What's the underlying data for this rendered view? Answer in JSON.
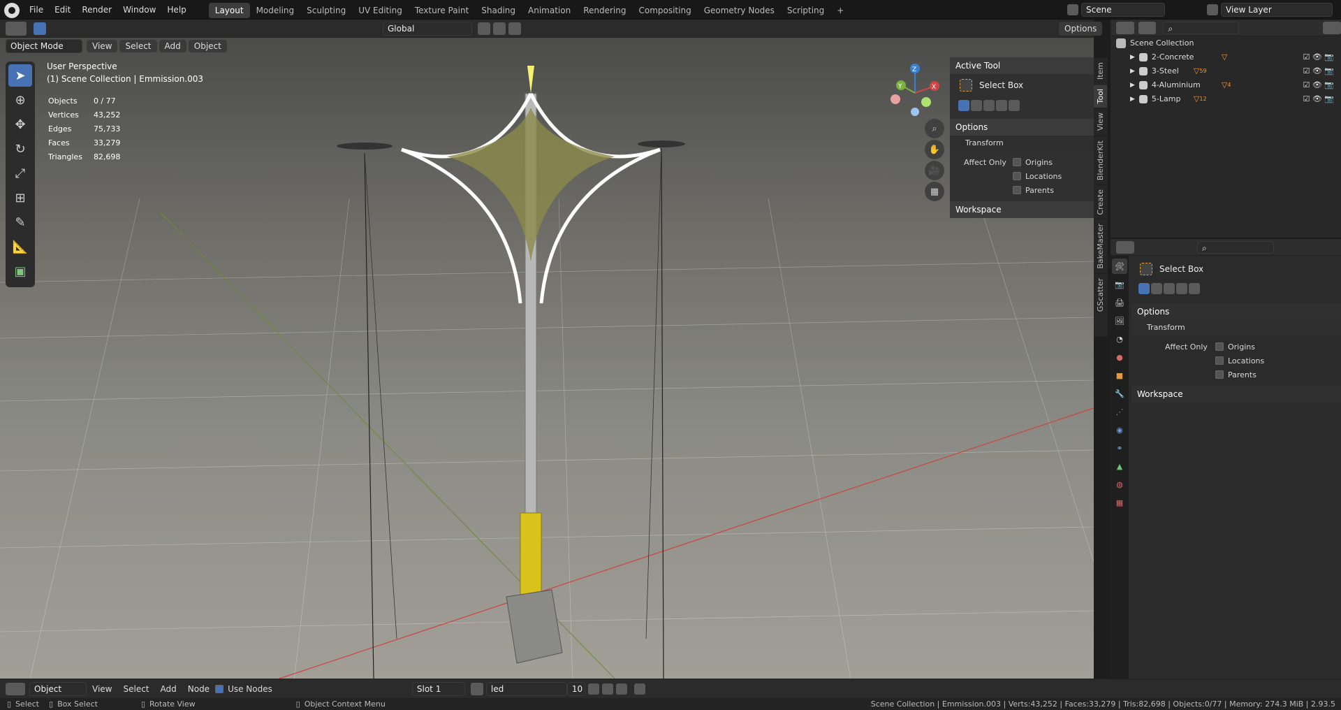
{
  "topbar": {
    "menus": [
      "File",
      "Edit",
      "Render",
      "Window",
      "Help"
    ],
    "workspaces": [
      "Layout",
      "Modeling",
      "Sculpting",
      "UV Editing",
      "Texture Paint",
      "Shading",
      "Animation",
      "Rendering",
      "Compositing",
      "Geometry Nodes",
      "Scripting"
    ],
    "active_workspace": "Layout",
    "scene_label": "Scene",
    "view_layer_label": "View Layer"
  },
  "viewport_header": {
    "mode": "Object Mode",
    "menus": [
      "View",
      "Select",
      "Add",
      "Object"
    ],
    "orientation": "Global",
    "options_label": "Options"
  },
  "overlay": {
    "perspective": "User Perspective",
    "context": "(1) Scene Collection | Emmission.003",
    "stats": [
      {
        "label": "Objects",
        "value": "0 / 77"
      },
      {
        "label": "Vertices",
        "value": "43,252"
      },
      {
        "label": "Edges",
        "value": "75,733"
      },
      {
        "label": "Faces",
        "value": "33,279"
      },
      {
        "label": "Triangles",
        "value": "82,698"
      }
    ]
  },
  "gizmo": {
    "x": "X",
    "y": "Y",
    "z": "Z"
  },
  "npanel": {
    "active_tool_title": "Active Tool",
    "tool_name": "Select Box",
    "options_title": "Options",
    "transform_title": "Transform",
    "affect_only": "Affect Only",
    "checks": [
      "Origins",
      "Locations",
      "Parents"
    ],
    "workspace_title": "Workspace",
    "tabs": [
      "Item",
      "Tool",
      "View",
      "BlenderKit",
      "Create",
      "BakeMaster",
      "GScatter"
    ],
    "active_tab": "Tool"
  },
  "outliner": {
    "root": "Scene Collection",
    "collections": [
      {
        "name": "2-Concrete",
        "badge": ""
      },
      {
        "name": "3-Steel",
        "badge": "59"
      },
      {
        "name": "4-Aluminium",
        "badge": "4"
      },
      {
        "name": "5-Lamp",
        "badge": "12"
      }
    ]
  },
  "properties": {
    "tool_name": "Select Box",
    "options_title": "Options",
    "transform_title": "Transform",
    "affect_only": "Affect Only",
    "checks": [
      "Origins",
      "Locations",
      "Parents"
    ],
    "workspace_title": "Workspace"
  },
  "node_header": {
    "editor": "Object",
    "menus": [
      "View",
      "Select",
      "Add",
      "Node"
    ],
    "use_nodes": "Use Nodes",
    "slot": "Slot 1",
    "material": "led",
    "users": "10"
  },
  "statusbar": {
    "select": "Select",
    "box_select": "Box Select",
    "rotate": "Rotate View",
    "context_menu": "Object Context Menu",
    "info": "Scene Collection | Emmission.003 | Verts:43,252 | Faces:33,279 | Tris:82,698 | Objects:0/77 | Memory: 274.3 MiB | 2.93.5"
  }
}
